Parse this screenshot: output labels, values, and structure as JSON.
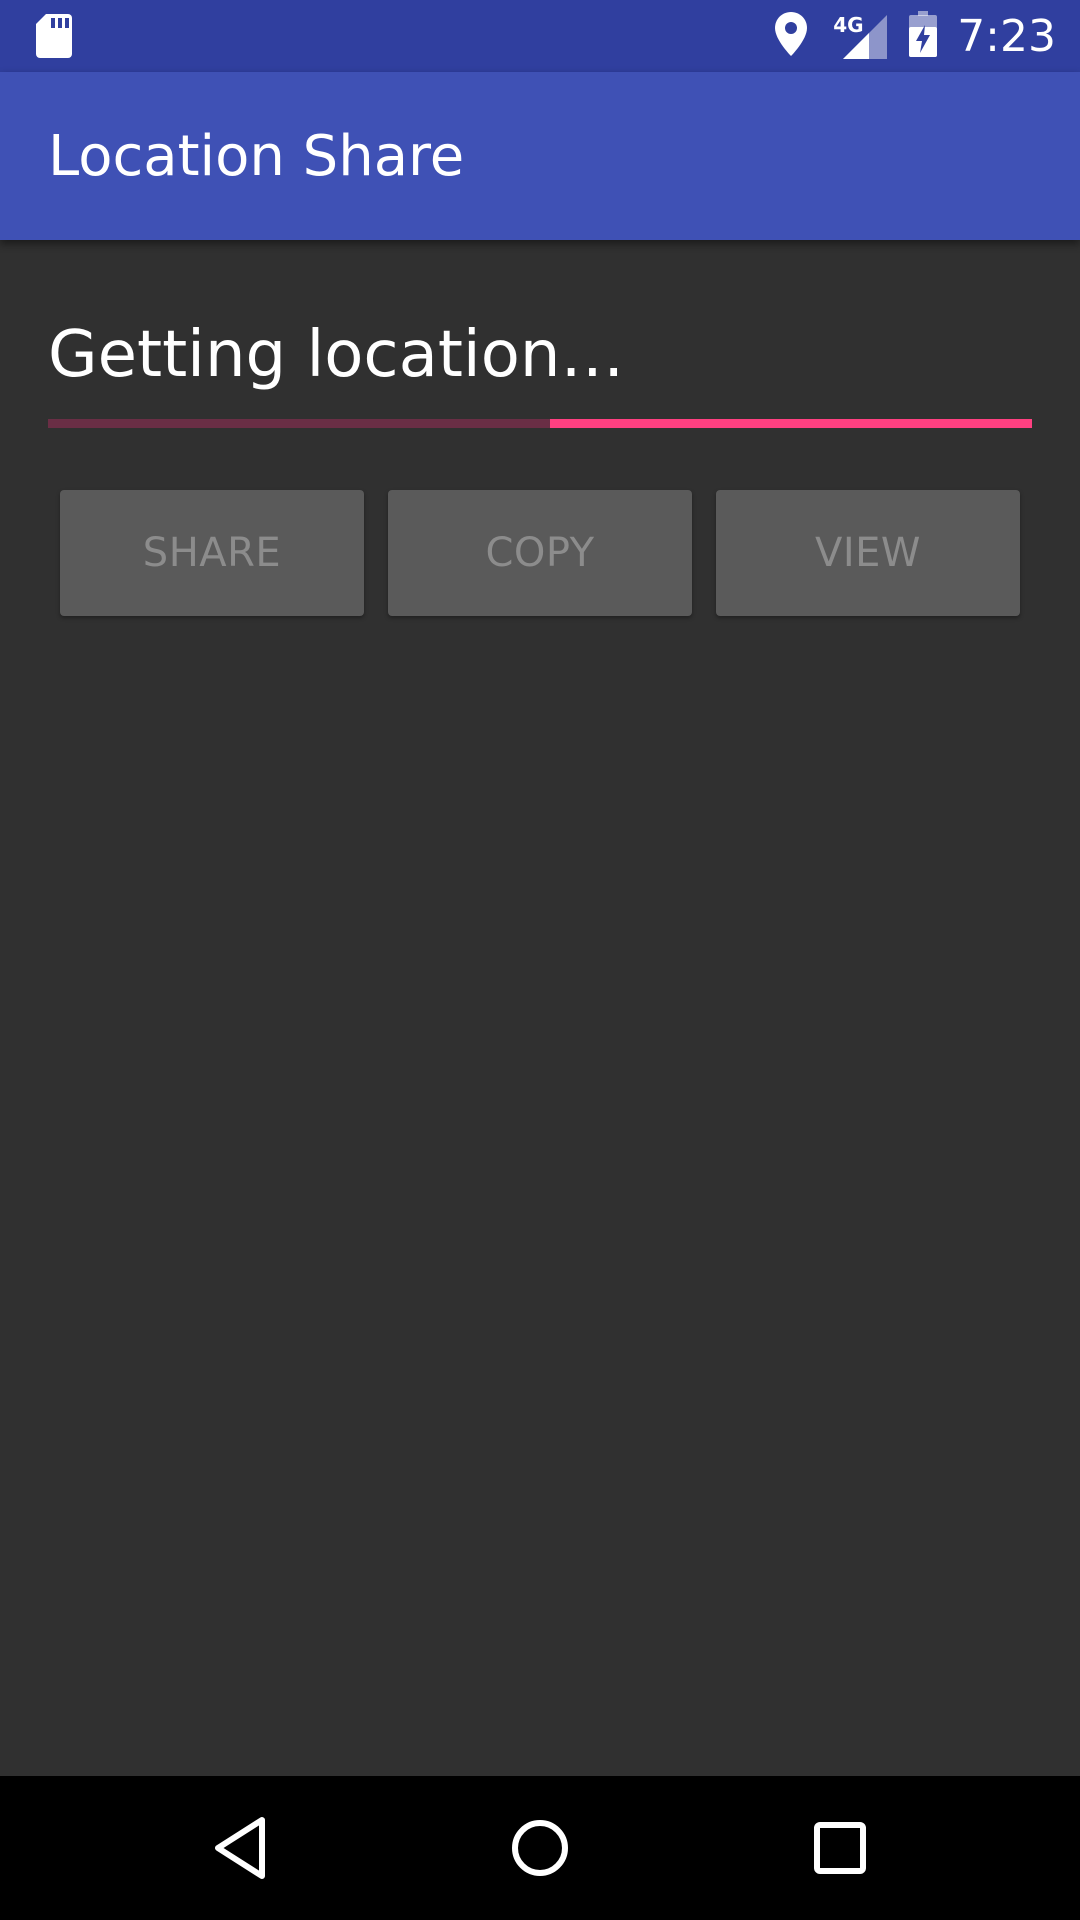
{
  "status_bar": {
    "time": "7:23",
    "network": "4G",
    "icons": [
      "sd-card-icon",
      "location-pin-icon",
      "cell-signal-icon",
      "battery-charging-icon"
    ]
  },
  "app_bar": {
    "title": "Location Share",
    "color": "#3F51B5",
    "status_color": "#303F9F"
  },
  "main": {
    "status_text": "Getting location…",
    "progress": {
      "indeterminate": true,
      "fill_start_percent": 51,
      "fill_end_percent": 100,
      "track_color": "#6A2E45",
      "fill_color": "#FF4081"
    },
    "buttons": [
      {
        "label": "SHARE",
        "enabled": false
      },
      {
        "label": "COPY",
        "enabled": false
      },
      {
        "label": "VIEW",
        "enabled": false
      }
    ]
  },
  "nav_bar": {
    "icons": [
      "back-icon",
      "home-icon",
      "recents-icon"
    ]
  }
}
